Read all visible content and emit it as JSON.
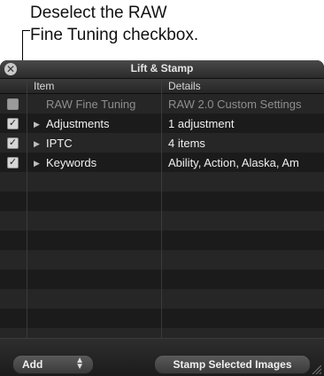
{
  "callout": {
    "line1": "Deselect the RAW",
    "line2": "Fine Tuning checkbox."
  },
  "window": {
    "title": "Lift & Stamp",
    "close_icon": "close-icon"
  },
  "table": {
    "headers": {
      "item": "Item",
      "details": "Details"
    },
    "rows": [
      {
        "checked": false,
        "expandable": false,
        "item": "RAW Fine Tuning",
        "details": "RAW 2.0 Custom Settings",
        "disabled": true
      },
      {
        "checked": true,
        "expandable": true,
        "item": "Adjustments",
        "details": "1 adjustment",
        "disabled": false
      },
      {
        "checked": true,
        "expandable": true,
        "item": "IPTC",
        "details": "4 items",
        "disabled": false
      },
      {
        "checked": true,
        "expandable": true,
        "item": "Keywords",
        "details": "Ability, Action, Alaska, Am",
        "disabled": false
      }
    ]
  },
  "bottom": {
    "add_label": "Add",
    "stamp_label": "Stamp Selected Images"
  }
}
